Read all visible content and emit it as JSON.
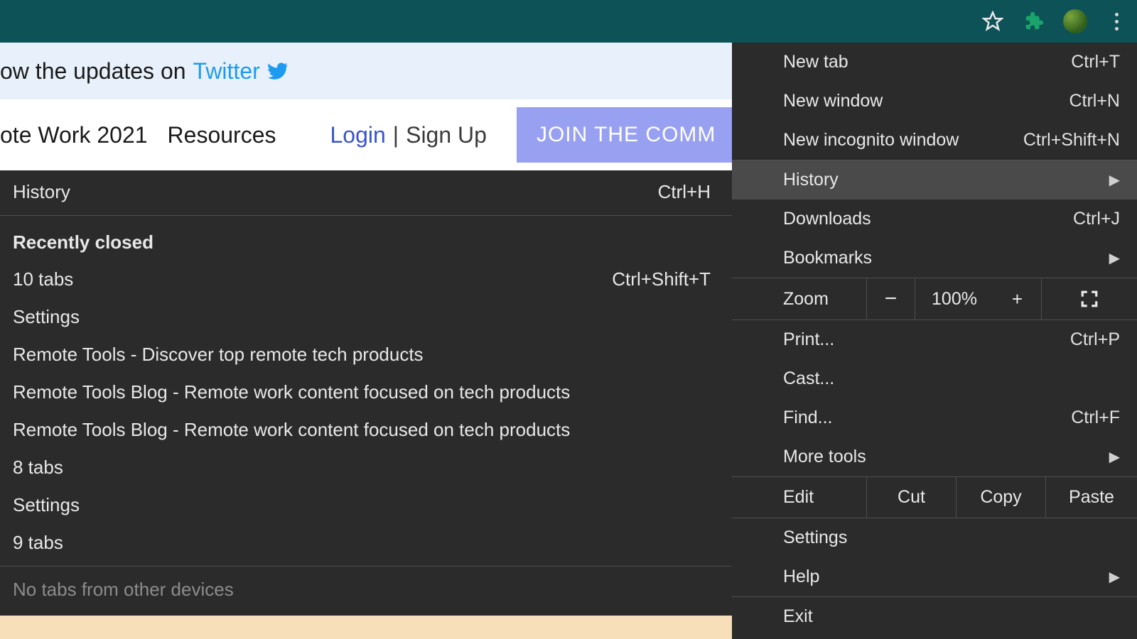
{
  "toolbar": {
    "star_icon": "star-icon",
    "extensions_icon": "puzzle-icon",
    "avatar": "avatar",
    "menu_icon": "kebab-menu-icon"
  },
  "page": {
    "banner_text_left": "ow the updates on ",
    "banner_link": "Twitter",
    "nav_items": [
      "ote Work 2021",
      "Resources"
    ],
    "login": "Login",
    "pipe": "|",
    "signup": "Sign Up",
    "join_button": "JOIN THE COMM"
  },
  "main_menu": {
    "items": [
      {
        "label": "New tab",
        "shortcut": "Ctrl+T"
      },
      {
        "label": "New window",
        "shortcut": "Ctrl+N"
      },
      {
        "label": "New incognito window",
        "shortcut": "Ctrl+Shift+N"
      }
    ],
    "history": {
      "label": "History",
      "submenu": true
    },
    "downloads": {
      "label": "Downloads",
      "shortcut": "Ctrl+J"
    },
    "bookmarks": {
      "label": "Bookmarks",
      "submenu": true
    },
    "zoom": {
      "label": "Zoom",
      "minus": "−",
      "value": "100%",
      "plus": "+"
    },
    "print": {
      "label": "Print...",
      "shortcut": "Ctrl+P"
    },
    "cast": {
      "label": "Cast..."
    },
    "find": {
      "label": "Find...",
      "shortcut": "Ctrl+F"
    },
    "more_tools": {
      "label": "More tools",
      "submenu": true
    },
    "edit": {
      "label": "Edit",
      "cut": "Cut",
      "copy": "Copy",
      "paste": "Paste"
    },
    "settings": {
      "label": "Settings"
    },
    "help": {
      "label": "Help",
      "submenu": true
    },
    "exit": {
      "label": "Exit"
    }
  },
  "history_panel": {
    "header": {
      "label": "History",
      "shortcut": "Ctrl+H"
    },
    "recently_closed_heading": "Recently closed",
    "items": [
      {
        "label": "10 tabs",
        "shortcut": "Ctrl+Shift+T"
      },
      {
        "label": "Settings"
      },
      {
        "label": "Remote Tools - Discover top remote tech products"
      },
      {
        "label": "Remote Tools Blog - Remote work content focused on tech products"
      },
      {
        "label": "Remote Tools Blog - Remote work content focused on tech products"
      },
      {
        "label": "8 tabs"
      },
      {
        "label": "Settings"
      },
      {
        "label": "9 tabs"
      }
    ],
    "no_tabs": "No tabs from other devices"
  }
}
